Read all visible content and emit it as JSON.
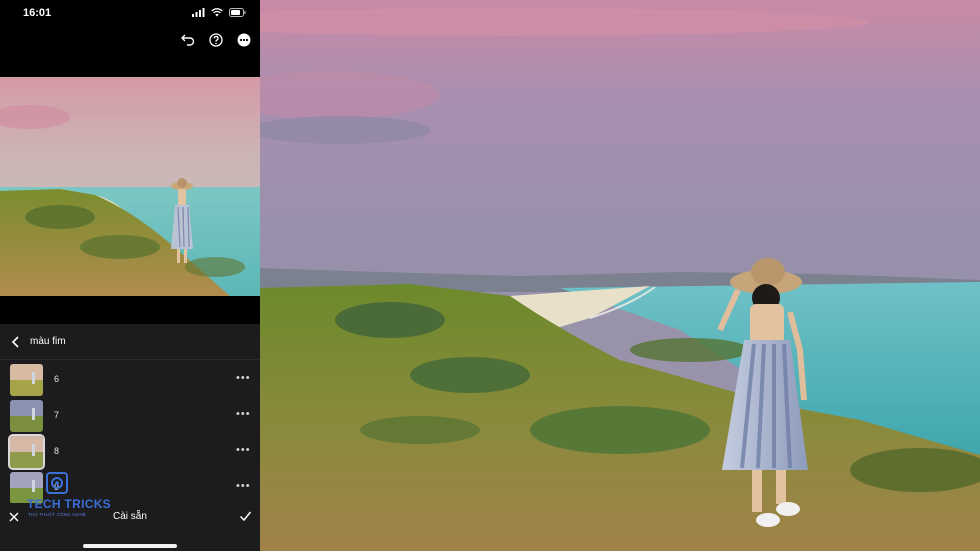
{
  "status_bar": {
    "time": "16:01",
    "icons": [
      "signal-icon",
      "wifi-icon",
      "battery-icon"
    ]
  },
  "top_actions": [
    "undo-icon",
    "help-icon",
    "more-icon"
  ],
  "panel": {
    "title": "màu fim",
    "presets": [
      {
        "label": "6",
        "selected": false
      },
      {
        "label": "7",
        "selected": false
      },
      {
        "label": "8",
        "selected": true
      },
      {
        "label": "9",
        "selected": false
      }
    ],
    "more_glyph": "•••"
  },
  "bottom_bar": {
    "label": "Cài sẵn"
  },
  "watermark": {
    "name": "TECH TRICKS",
    "sub": "THỦ THUẬT CÔNG NGHỆ"
  },
  "colors": {
    "panel_bg": "#1c1c1e",
    "sky_top": "#c98aa6",
    "sky_mid": "#9c90ab",
    "sea": "#5fbcc0",
    "grass": "#6f8a2a",
    "watermark_blue": "#3b6fd8"
  }
}
